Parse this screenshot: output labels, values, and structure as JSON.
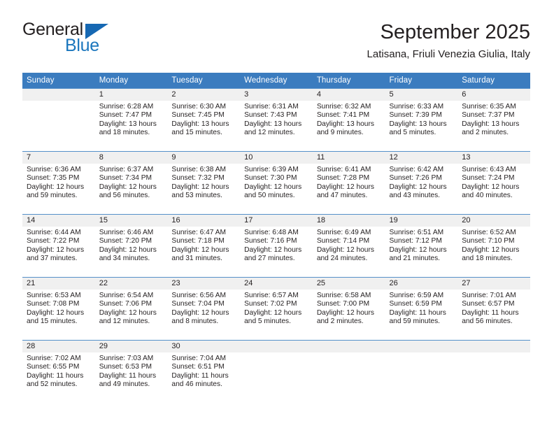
{
  "brand": {
    "name_top": "General",
    "name_bottom": "Blue",
    "triangle_icon": "triangle-icon",
    "color_dark": "#231f20",
    "color_blue": "#1b76bd"
  },
  "header": {
    "month_title": "September 2025",
    "location": "Latisana, Friuli Venezia Giulia, Italy"
  },
  "theme": {
    "header_bg": "#3b7cbf",
    "header_text": "#ffffff",
    "daynum_band": "#f0f0f0",
    "grid_line": "#5590c9"
  },
  "calendar": {
    "weekday_headers": [
      "Sunday",
      "Monday",
      "Tuesday",
      "Wednesday",
      "Thursday",
      "Friday",
      "Saturday"
    ],
    "weeks": [
      [
        {
          "day": "",
          "sunrise": "",
          "sunset": "",
          "daylight1": "",
          "daylight2": ""
        },
        {
          "day": "1",
          "sunrise": "Sunrise: 6:28 AM",
          "sunset": "Sunset: 7:47 PM",
          "daylight1": "Daylight: 13 hours",
          "daylight2": "and 18 minutes."
        },
        {
          "day": "2",
          "sunrise": "Sunrise: 6:30 AM",
          "sunset": "Sunset: 7:45 PM",
          "daylight1": "Daylight: 13 hours",
          "daylight2": "and 15 minutes."
        },
        {
          "day": "3",
          "sunrise": "Sunrise: 6:31 AM",
          "sunset": "Sunset: 7:43 PM",
          "daylight1": "Daylight: 13 hours",
          "daylight2": "and 12 minutes."
        },
        {
          "day": "4",
          "sunrise": "Sunrise: 6:32 AM",
          "sunset": "Sunset: 7:41 PM",
          "daylight1": "Daylight: 13 hours",
          "daylight2": "and 9 minutes."
        },
        {
          "day": "5",
          "sunrise": "Sunrise: 6:33 AM",
          "sunset": "Sunset: 7:39 PM",
          "daylight1": "Daylight: 13 hours",
          "daylight2": "and 5 minutes."
        },
        {
          "day": "6",
          "sunrise": "Sunrise: 6:35 AM",
          "sunset": "Sunset: 7:37 PM",
          "daylight1": "Daylight: 13 hours",
          "daylight2": "and 2 minutes."
        }
      ],
      [
        {
          "day": "7",
          "sunrise": "Sunrise: 6:36 AM",
          "sunset": "Sunset: 7:35 PM",
          "daylight1": "Daylight: 12 hours",
          "daylight2": "and 59 minutes."
        },
        {
          "day": "8",
          "sunrise": "Sunrise: 6:37 AM",
          "sunset": "Sunset: 7:34 PM",
          "daylight1": "Daylight: 12 hours",
          "daylight2": "and 56 minutes."
        },
        {
          "day": "9",
          "sunrise": "Sunrise: 6:38 AM",
          "sunset": "Sunset: 7:32 PM",
          "daylight1": "Daylight: 12 hours",
          "daylight2": "and 53 minutes."
        },
        {
          "day": "10",
          "sunrise": "Sunrise: 6:39 AM",
          "sunset": "Sunset: 7:30 PM",
          "daylight1": "Daylight: 12 hours",
          "daylight2": "and 50 minutes."
        },
        {
          "day": "11",
          "sunrise": "Sunrise: 6:41 AM",
          "sunset": "Sunset: 7:28 PM",
          "daylight1": "Daylight: 12 hours",
          "daylight2": "and 47 minutes."
        },
        {
          "day": "12",
          "sunrise": "Sunrise: 6:42 AM",
          "sunset": "Sunset: 7:26 PM",
          "daylight1": "Daylight: 12 hours",
          "daylight2": "and 43 minutes."
        },
        {
          "day": "13",
          "sunrise": "Sunrise: 6:43 AM",
          "sunset": "Sunset: 7:24 PM",
          "daylight1": "Daylight: 12 hours",
          "daylight2": "and 40 minutes."
        }
      ],
      [
        {
          "day": "14",
          "sunrise": "Sunrise: 6:44 AM",
          "sunset": "Sunset: 7:22 PM",
          "daylight1": "Daylight: 12 hours",
          "daylight2": "and 37 minutes."
        },
        {
          "day": "15",
          "sunrise": "Sunrise: 6:46 AM",
          "sunset": "Sunset: 7:20 PM",
          "daylight1": "Daylight: 12 hours",
          "daylight2": "and 34 minutes."
        },
        {
          "day": "16",
          "sunrise": "Sunrise: 6:47 AM",
          "sunset": "Sunset: 7:18 PM",
          "daylight1": "Daylight: 12 hours",
          "daylight2": "and 31 minutes."
        },
        {
          "day": "17",
          "sunrise": "Sunrise: 6:48 AM",
          "sunset": "Sunset: 7:16 PM",
          "daylight1": "Daylight: 12 hours",
          "daylight2": "and 27 minutes."
        },
        {
          "day": "18",
          "sunrise": "Sunrise: 6:49 AM",
          "sunset": "Sunset: 7:14 PM",
          "daylight1": "Daylight: 12 hours",
          "daylight2": "and 24 minutes."
        },
        {
          "day": "19",
          "sunrise": "Sunrise: 6:51 AM",
          "sunset": "Sunset: 7:12 PM",
          "daylight1": "Daylight: 12 hours",
          "daylight2": "and 21 minutes."
        },
        {
          "day": "20",
          "sunrise": "Sunrise: 6:52 AM",
          "sunset": "Sunset: 7:10 PM",
          "daylight1": "Daylight: 12 hours",
          "daylight2": "and 18 minutes."
        }
      ],
      [
        {
          "day": "21",
          "sunrise": "Sunrise: 6:53 AM",
          "sunset": "Sunset: 7:08 PM",
          "daylight1": "Daylight: 12 hours",
          "daylight2": "and 15 minutes."
        },
        {
          "day": "22",
          "sunrise": "Sunrise: 6:54 AM",
          "sunset": "Sunset: 7:06 PM",
          "daylight1": "Daylight: 12 hours",
          "daylight2": "and 12 minutes."
        },
        {
          "day": "23",
          "sunrise": "Sunrise: 6:56 AM",
          "sunset": "Sunset: 7:04 PM",
          "daylight1": "Daylight: 12 hours",
          "daylight2": "and 8 minutes."
        },
        {
          "day": "24",
          "sunrise": "Sunrise: 6:57 AM",
          "sunset": "Sunset: 7:02 PM",
          "daylight1": "Daylight: 12 hours",
          "daylight2": "and 5 minutes."
        },
        {
          "day": "25",
          "sunrise": "Sunrise: 6:58 AM",
          "sunset": "Sunset: 7:00 PM",
          "daylight1": "Daylight: 12 hours",
          "daylight2": "and 2 minutes."
        },
        {
          "day": "26",
          "sunrise": "Sunrise: 6:59 AM",
          "sunset": "Sunset: 6:59 PM",
          "daylight1": "Daylight: 11 hours",
          "daylight2": "and 59 minutes."
        },
        {
          "day": "27",
          "sunrise": "Sunrise: 7:01 AM",
          "sunset": "Sunset: 6:57 PM",
          "daylight1": "Daylight: 11 hours",
          "daylight2": "and 56 minutes."
        }
      ],
      [
        {
          "day": "28",
          "sunrise": "Sunrise: 7:02 AM",
          "sunset": "Sunset: 6:55 PM",
          "daylight1": "Daylight: 11 hours",
          "daylight2": "and 52 minutes."
        },
        {
          "day": "29",
          "sunrise": "Sunrise: 7:03 AM",
          "sunset": "Sunset: 6:53 PM",
          "daylight1": "Daylight: 11 hours",
          "daylight2": "and 49 minutes."
        },
        {
          "day": "30",
          "sunrise": "Sunrise: 7:04 AM",
          "sunset": "Sunset: 6:51 PM",
          "daylight1": "Daylight: 11 hours",
          "daylight2": "and 46 minutes."
        },
        {
          "day": "",
          "sunrise": "",
          "sunset": "",
          "daylight1": "",
          "daylight2": ""
        },
        {
          "day": "",
          "sunrise": "",
          "sunset": "",
          "daylight1": "",
          "daylight2": ""
        },
        {
          "day": "",
          "sunrise": "",
          "sunset": "",
          "daylight1": "",
          "daylight2": ""
        },
        {
          "day": "",
          "sunrise": "",
          "sunset": "",
          "daylight1": "",
          "daylight2": ""
        }
      ]
    ]
  }
}
